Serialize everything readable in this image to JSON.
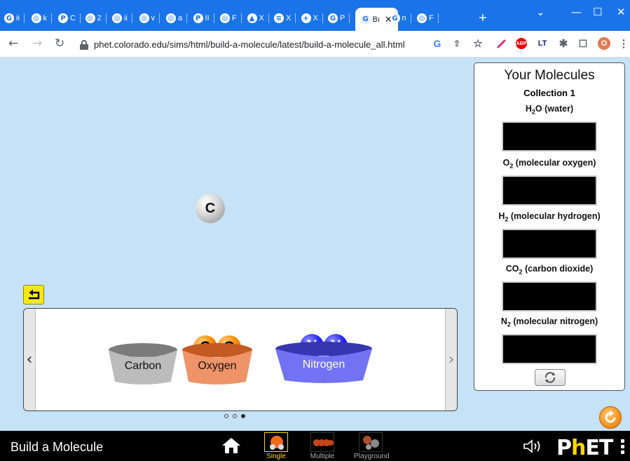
{
  "browser": {
    "tabs": [
      {
        "fav": "G",
        "label": "ii"
      },
      {
        "fav": "◎",
        "label": "k"
      },
      {
        "fav": "P",
        "label": "C"
      },
      {
        "fav": "◎",
        "label": "2"
      },
      {
        "fav": "◎",
        "label": "ii"
      },
      {
        "fav": "◎",
        "label": "v"
      },
      {
        "fav": "◎",
        "label": "a"
      },
      {
        "fav": "P",
        "label": "II"
      },
      {
        "fav": "◎",
        "label": "F"
      },
      {
        "fav": "▲",
        "label": "X"
      },
      {
        "fav": "≡",
        "label": "X"
      },
      {
        "fav": "+",
        "label": "X"
      },
      {
        "fav": "G",
        "label": "P"
      }
    ],
    "active_tab": {
      "fav": "G",
      "label": "Bı"
    },
    "after_tabs": [
      {
        "fav": "G",
        "label": "n"
      },
      {
        "fav": "◎",
        "label": "F"
      }
    ],
    "url": "phet.colorado.edu/sims/html/build-a-molecule/latest/build-a-molecule_all.html",
    "profile_initial": "O",
    "ext_labels": {
      "abp": "ABP",
      "lt": "LT"
    }
  },
  "sim": {
    "free_atom": "C",
    "buckets": [
      {
        "label": "Carbon",
        "atoms": [],
        "colors": {
          "top": "#7b7b7b",
          "front": "#bcbcbc"
        }
      },
      {
        "label": "Oxygen",
        "atoms": [
          "O",
          "O"
        ],
        "colors": {
          "top": "#c25a22",
          "front": "#ee9468"
        }
      },
      {
        "label": "Nitrogen",
        "atoms": [
          "N",
          "N"
        ],
        "colors": {
          "top": "#3636b0",
          "front": "#7272f2"
        }
      }
    ],
    "page_dots": [
      false,
      false,
      true
    ],
    "panel": {
      "title": "Your Molecules",
      "collection": "Collection 1",
      "goals": [
        {
          "formula_parts": [
            "H",
            "2",
            "O"
          ],
          "name": " (water)"
        },
        {
          "formula_parts": [
            "O",
            "2",
            ""
          ],
          "name": " (molecular oxygen)"
        },
        {
          "formula_parts": [
            "H",
            "2",
            ""
          ],
          "name": " (molecular hydrogen)"
        },
        {
          "formula_parts": [
            "CO",
            "2",
            ""
          ],
          "name": " (carbon dioxide)"
        },
        {
          "formula_parts": [
            "N",
            "2",
            ""
          ],
          "name": " (molecular nitrogen)"
        }
      ]
    }
  },
  "navbar": {
    "title": "Build a Molecule",
    "screens": [
      {
        "label": "Single",
        "selected": true
      },
      {
        "label": "Multiple",
        "selected": false
      },
      {
        "label": "Playground",
        "selected": false
      }
    ],
    "logo": {
      "p": "P",
      "h": "h",
      "et": "ET"
    }
  }
}
